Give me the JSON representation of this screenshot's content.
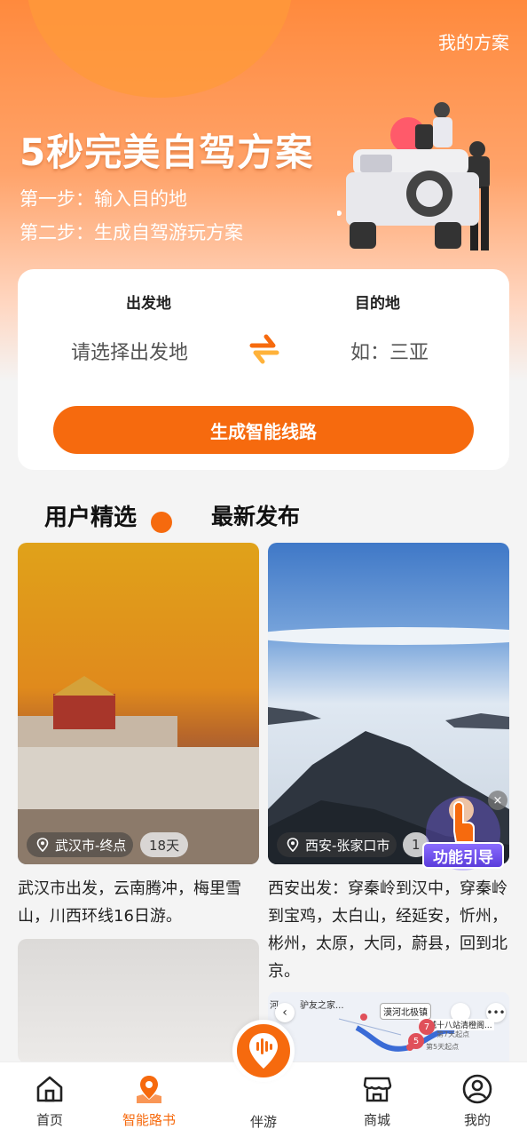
{
  "header": {
    "my_plan": "我的方案",
    "title": "5秒完美自驾方案",
    "step1": "第一步：输入目的地",
    "step2": "第二步：生成自驾游玩方案"
  },
  "route": {
    "from_label": "出发地",
    "to_label": "目的地",
    "from_placeholder": "请选择出发地",
    "to_placeholder": "如：三亚",
    "generate_button": "生成智能线路"
  },
  "tabs": [
    {
      "label": "用户精选",
      "active": true
    },
    {
      "label": "最新发布",
      "active": false
    }
  ],
  "cards": [
    {
      "location": "武汉市-终点",
      "days": "18天",
      "desc": "武汉市出发，云南腾冲，梅里雪山，川西环线16日游。"
    },
    {
      "location": "西安-张家口市",
      "days": "1",
      "desc": "西安出发：穿秦岭到汉中，穿秦岭到宝鸡，太白山，经延安，忻州，彬州，太原，大同，蔚县，回到北京。"
    }
  ],
  "guide": {
    "label": "功能引导",
    "close": "×"
  },
  "map_preview": {
    "label1": "河",
    "label2": "驴友之家...",
    "label3": "漠河北极镇",
    "label4": "塔城十八站清橙阁...",
    "label5": "第7天起点",
    "label6": "第5天起点",
    "num1": "7",
    "num2": "5"
  },
  "bottom_nav": [
    {
      "label": "首页",
      "icon": "home-icon",
      "active": false
    },
    {
      "label": "智能路书",
      "icon": "map-pin-icon",
      "active": true
    },
    {
      "label": "伴游",
      "icon": "voice-icon",
      "active": false
    },
    {
      "label": "商城",
      "icon": "store-icon",
      "active": false
    },
    {
      "label": "我的",
      "icon": "user-icon",
      "active": false
    }
  ],
  "colors": {
    "accent": "#f66a0e",
    "hero_top": "#ff8a3d"
  }
}
